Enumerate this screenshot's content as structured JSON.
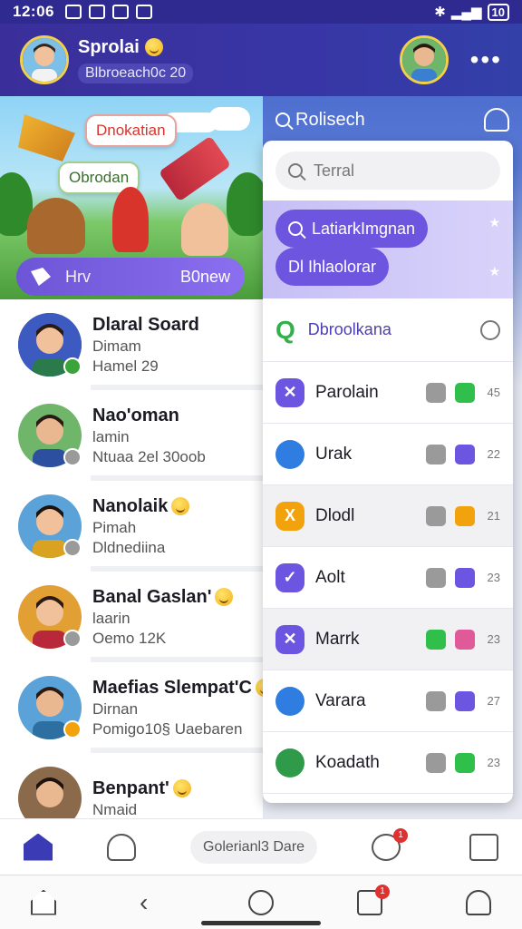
{
  "status_bar": {
    "time": "12:06",
    "battery": "10"
  },
  "header": {
    "title": "Sprolai",
    "subtitle": "Blbroeach0c 20"
  },
  "banner": {
    "speech_top": "Dnokatian",
    "speech_mid": "Obrodan",
    "button_left": "Hrv",
    "button_right": "B0new"
  },
  "chats": [
    {
      "name": "Dlaral Soard",
      "line1": "Dimam",
      "line2": "Hamel 29",
      "badge_color": "#3aa33a"
    },
    {
      "name": "Nao'oman",
      "line1": "lamin",
      "line2": "Ntuaa 2el 30oob",
      "badge_color": "#9a9a9a"
    },
    {
      "name": "Nanolaik",
      "line1": "Pimah",
      "line2": "Dldnediina",
      "badge_color": "#9a9a9a"
    },
    {
      "name": "Banal Gaslan'",
      "line1": "laarin",
      "line2": "Oemo 12K",
      "badge_color": "#9a9a9a"
    },
    {
      "name": "Maefias Slempat'C",
      "line1": "Dirnan",
      "line2": "Pomigo10§ Uaebaren",
      "badge_color": "#f2a20c"
    },
    {
      "name": "Benpant'",
      "line1": "Nmaid",
      "line2": "",
      "badge_color": "#9a9a9a"
    }
  ],
  "right_header": {
    "search_label": "Rolisech"
  },
  "dropdown": {
    "search_placeholder": "Terral",
    "suggestions": [
      "LatiarkImgnan",
      "Dl Ihlaolorar"
    ],
    "group_label": "Dbroolkana",
    "rows": [
      {
        "label": "Parolain",
        "num": "45",
        "icon_color": "#6c55e0",
        "icon_glyph": "✕",
        "chip1": "#9a9a9a",
        "chip2": "#2fbf4a"
      },
      {
        "label": "Urak",
        "num": "22",
        "icon_color": "#2f7de0",
        "icon_glyph": "",
        "chip1": "#9a9a9a",
        "chip2": "#6c55e0"
      },
      {
        "label": "Dlodl",
        "num": "21",
        "icon_color": "#f2a20c",
        "icon_glyph": "X",
        "chip1": "#9a9a9a",
        "chip2": "#f2a20c"
      },
      {
        "label": "Aolt",
        "num": "23",
        "icon_color": "#6c55e0",
        "icon_glyph": "✓",
        "chip1": "#9a9a9a",
        "chip2": "#6c55e0"
      },
      {
        "label": "Marrk",
        "num": "23",
        "icon_color": "#6c55e0",
        "icon_glyph": "✕",
        "chip1": "#2fbf4a",
        "chip2": "#e05a9a"
      },
      {
        "label": "Varara",
        "num": "27",
        "icon_color": "#2f7de0",
        "icon_glyph": "",
        "chip1": "#9a9a9a",
        "chip2": "#6c55e0"
      },
      {
        "label": "Koadath",
        "num": "23",
        "icon_color": "#2f9a4a",
        "icon_glyph": "",
        "chip1": "#9a9a9a",
        "chip2": "#2fbf4a"
      }
    ]
  },
  "app_bar": {
    "center_label": "Golerianl3 Dare",
    "notif_count": "1"
  },
  "system_nav": {
    "notif_count": "1"
  },
  "colors": {
    "header": "#3a2f9a",
    "accent": "#6c55e0"
  }
}
